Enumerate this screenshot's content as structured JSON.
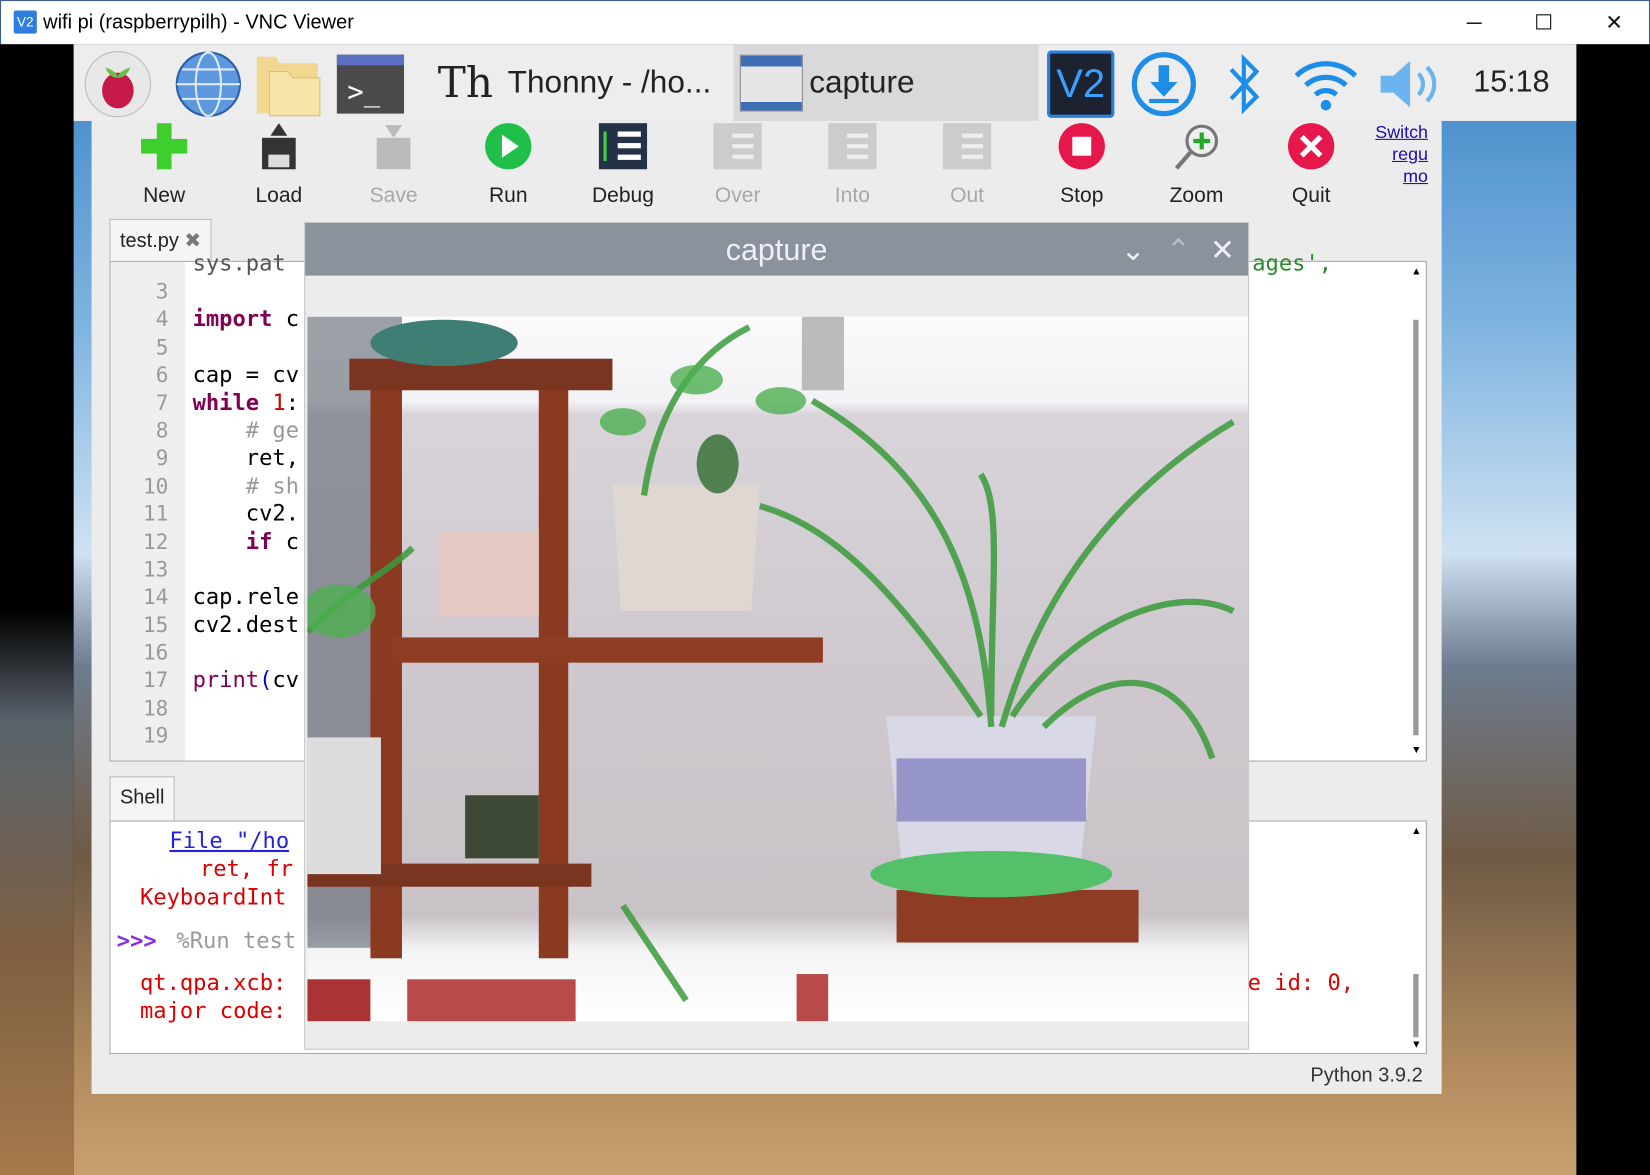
{
  "window": {
    "title": "wifi pi (raspberrypilh) - VNC Viewer",
    "minimize": "─",
    "maximize": "☐",
    "close": "✕"
  },
  "taskbar": {
    "tasks": [
      {
        "label": "Thonny  -  /ho..."
      },
      {
        "label": "capture"
      }
    ],
    "clock": "15:18",
    "tray": [
      "vnc-icon",
      "download-icon",
      "bluetooth-icon",
      "wifi-icon",
      "volume-icon"
    ]
  },
  "toolbar": {
    "items": [
      {
        "label": "New",
        "enabled": true
      },
      {
        "label": "Load",
        "enabled": true
      },
      {
        "label": "Save",
        "enabled": false
      },
      {
        "label": "Run",
        "enabled": true
      },
      {
        "label": "Debug",
        "enabled": true
      },
      {
        "label": "Over",
        "enabled": false
      },
      {
        "label": "Into",
        "enabled": false
      },
      {
        "label": "Out",
        "enabled": false
      },
      {
        "label": "Stop",
        "enabled": true
      },
      {
        "label": "Zoom",
        "enabled": true
      },
      {
        "label": "Quit",
        "enabled": true
      }
    ],
    "switch_link": [
      "Switch",
      "regu",
      "mo"
    ]
  },
  "editor": {
    "tab": "test.py",
    "tab_close": "✖",
    "line_numbers": [
      "3",
      "4",
      "5",
      "6",
      "7",
      "8",
      "9",
      "10",
      "11",
      "12",
      "13",
      "14",
      "15",
      "16",
      "17",
      "18",
      "19"
    ],
    "line2_partial": "sys.pat",
    "line2_right": "ages',"
  },
  "code": {
    "l4a": "import",
    "l4b": " c",
    "l6": "cap = cv",
    "l7a": "while",
    "l7b": " 1",
    "l7c": ":",
    "l8": "    # ge",
    "l9": "    ret,",
    "l10": "    # sh",
    "l11": "    cv2.",
    "l12a": "    if",
    "l12b": " c",
    "l14": "cap.rele",
    "l15": "cv2.dest",
    "l17a": "print",
    "l17b": "(",
    "l17c": "cv"
  },
  "shell": {
    "tab": "Shell",
    "file_link": "File \"/ho",
    "ret": "ret, fr",
    "kbd": "KeyboardInt",
    "prompt": ">>>",
    "run": " %Run test",
    "qt": "qt.qpa.xcb:",
    "major": "major code:",
    "right": "ce id: 0,"
  },
  "status": "Python 3.9.2",
  "capture": {
    "title": "capture",
    "min": "⌄",
    "max": "⌃",
    "close": "✕"
  }
}
